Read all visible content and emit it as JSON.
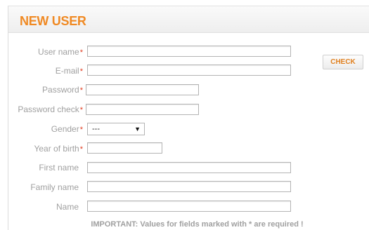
{
  "form": {
    "title": "NEW USER",
    "required_mark": "*",
    "fields": {
      "username": {
        "label": "User name",
        "value": ""
      },
      "email": {
        "label": "E-mail",
        "value": ""
      },
      "password": {
        "label": "Password",
        "value": ""
      },
      "password_check": {
        "label": "Password check",
        "value": ""
      },
      "gender": {
        "label": "Gender",
        "selected": "---"
      },
      "year_of_birth": {
        "label": "Year of birth",
        "value": ""
      },
      "first_name": {
        "label": "First name",
        "value": ""
      },
      "family_name": {
        "label": "Family name",
        "value": ""
      },
      "name": {
        "label": "Name",
        "value": ""
      }
    },
    "check_button": "CHECK",
    "footnote": "IMPORTANT: Values for fields marked with * are required !"
  },
  "colors": {
    "title": "#f08a24",
    "label": "#a0a0a0",
    "required": "#e03a1e",
    "button_text": "#e0801f"
  }
}
